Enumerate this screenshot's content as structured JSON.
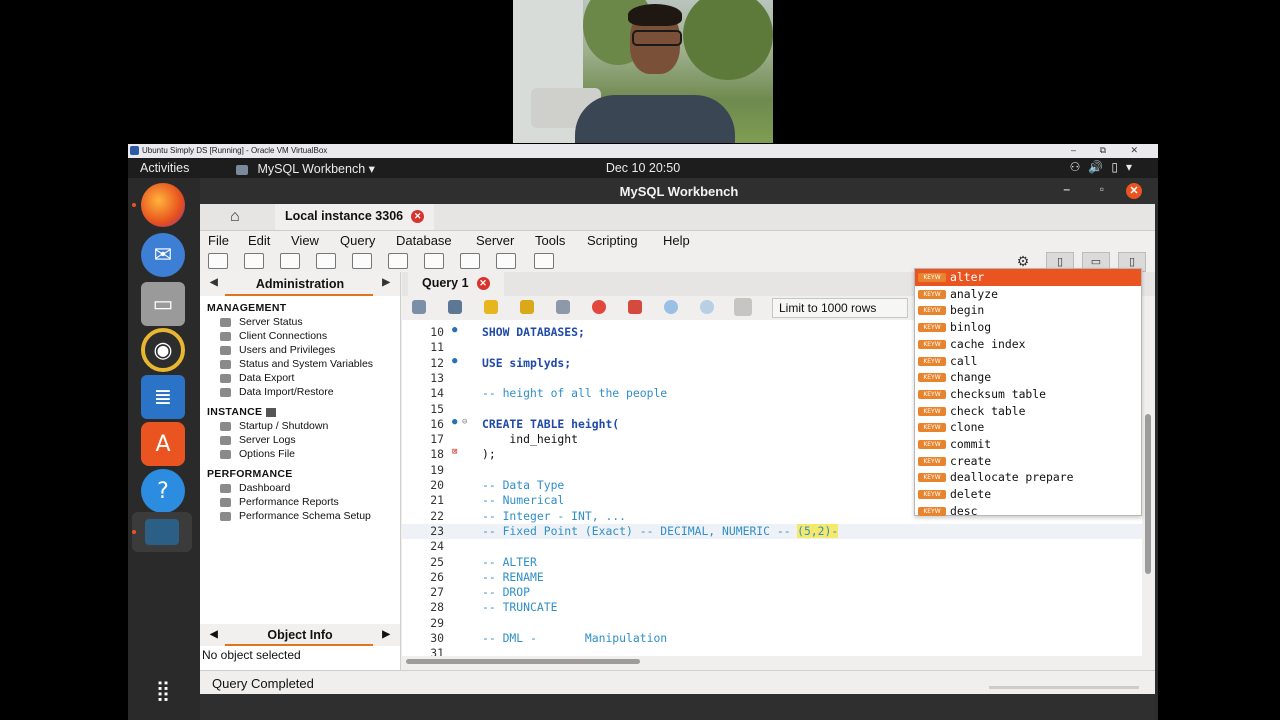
{
  "vbox": {
    "title": "Ubuntu Simply DS [Running] - Oracle VM VirtualBox"
  },
  "topbar": {
    "activities": "Activities",
    "app_menu": "MySQL Workbench ▾",
    "clock": "Dec 10  20:50"
  },
  "window": {
    "title": "MySQL Workbench"
  },
  "connection_tab": {
    "label": "Local instance 3306"
  },
  "menu": [
    "File",
    "Edit",
    "View",
    "Query",
    "Database",
    "Server",
    "Tools",
    "Scripting",
    "Help"
  ],
  "sidebar": {
    "title": "Administration",
    "management_label": "MANAGEMENT",
    "management": [
      "Server Status",
      "Client Connections",
      "Users and Privileges",
      "Status and System Variables",
      "Data Export",
      "Data Import/Restore"
    ],
    "instance_label": "INSTANCE",
    "instance": [
      "Startup / Shutdown",
      "Server Logs",
      "Options File"
    ],
    "performance_label": "PERFORMANCE",
    "performance": [
      "Dashboard",
      "Performance Reports",
      "Performance Schema Setup"
    ]
  },
  "object_info": {
    "title": "Object Info",
    "empty": "No object selected"
  },
  "query_tab": {
    "label": "Query 1"
  },
  "limit_select": {
    "value": "Limit to 1000 rows"
  },
  "editor": {
    "lines": [
      {
        "n": "10",
        "code": "SHOW DATABASES;"
      },
      {
        "n": "11",
        "code": ""
      },
      {
        "n": "12",
        "code": "USE simplyds;"
      },
      {
        "n": "13",
        "code": ""
      },
      {
        "n": "14",
        "code": "-- height of all the people"
      },
      {
        "n": "15",
        "code": ""
      },
      {
        "n": "16",
        "code": "CREATE TABLE height("
      },
      {
        "n": "17",
        "code": "    ind_height"
      },
      {
        "n": "18",
        "code": ");"
      },
      {
        "n": "19",
        "code": ""
      },
      {
        "n": "20",
        "code": "-- Data Type"
      },
      {
        "n": "21",
        "code": "-- Numerical"
      },
      {
        "n": "22",
        "code": "-- Integer - INT, ..."
      },
      {
        "n": "23",
        "code": "-- Fixed Point (Exact) -- DECIMAL, NUMERIC -- "
      },
      {
        "n": "24",
        "code": ""
      },
      {
        "n": "25",
        "code": "-- ALTER"
      },
      {
        "n": "26",
        "code": "-- RENAME"
      },
      {
        "n": "27",
        "code": "-- DROP"
      },
      {
        "n": "28",
        "code": "-- TRUNCATE"
      },
      {
        "n": "29",
        "code": ""
      },
      {
        "n": "30",
        "code": "-- DML -       Manipulation"
      },
      {
        "n": "31",
        "code": ""
      }
    ],
    "line23_suffix": "(5,2)-"
  },
  "autocomplete": {
    "badge": "KEYW",
    "items": [
      "alter",
      "analyze",
      "begin",
      "binlog",
      "cache index",
      "call",
      "change",
      "checksum table",
      "check table",
      "clone",
      "commit",
      "create",
      "deallocate prepare",
      "delete",
      "desc"
    ]
  },
  "status": {
    "text": "Query Completed"
  },
  "colors": {
    "accent": "#e95420",
    "keyword": "#1f4aa8",
    "comment": "#2f8fc9"
  }
}
